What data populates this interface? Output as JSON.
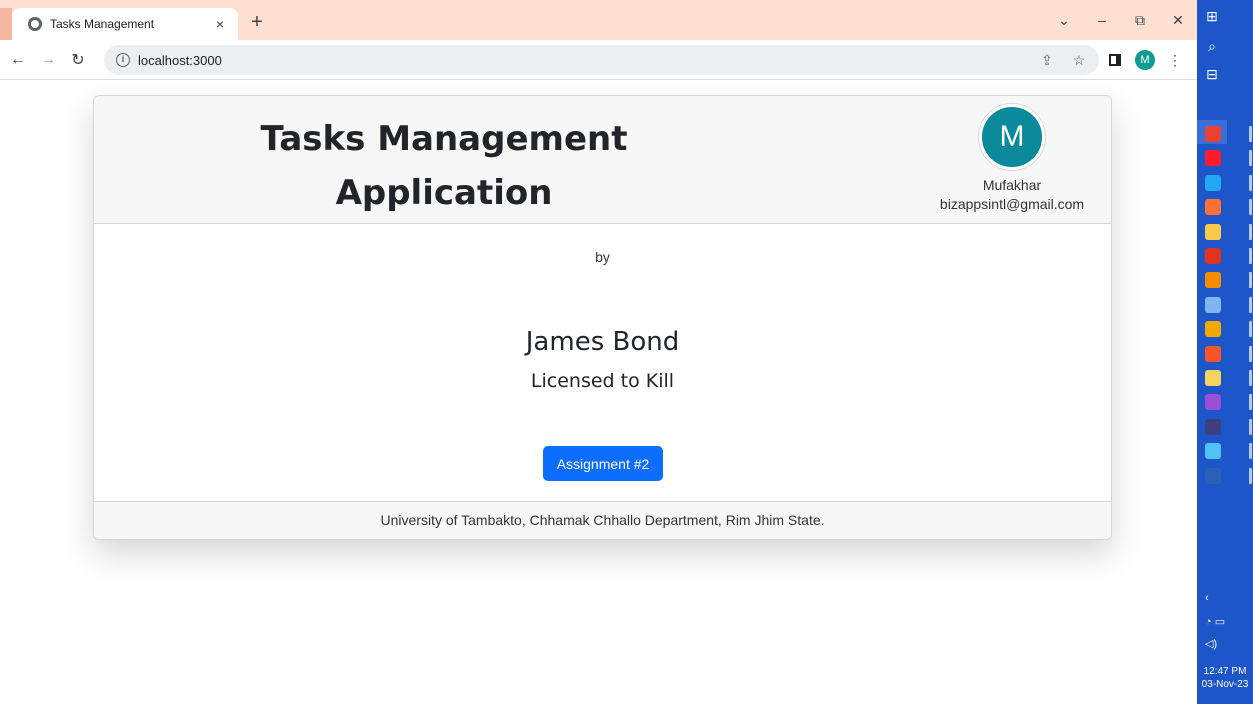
{
  "browser": {
    "tab_title": "Tasks Management",
    "tab_close": "×",
    "new_tab": "+",
    "url": "localhost:3000",
    "profile_initial": "M"
  },
  "header": {
    "title": "Tasks Management Application",
    "user": {
      "avatar_initial": "M",
      "name": "Mufakhar",
      "email": "bizappsintl@gmail.com"
    }
  },
  "body": {
    "by_label": "by",
    "author_name": "James Bond",
    "author_subtitle": "Licensed to Kill",
    "button_label": "Assignment #2"
  },
  "footer": {
    "text": "University of Tambakto, Chhamak Chhallo Department, Rim Jhim State."
  },
  "taskbar": {
    "time": "12:47 PM",
    "date": "03-Nov-23",
    "apps": [
      {
        "icon": "chrome-icon",
        "color": "#e94235"
      },
      {
        "icon": "opera-icon",
        "color": "#ff1b2d"
      },
      {
        "icon": "vscode-icon",
        "color": "#23a9f2"
      },
      {
        "icon": "firefox-icon",
        "color": "#ff7139"
      },
      {
        "icon": "file-explorer-icon",
        "color": "#f9c94b"
      },
      {
        "icon": "pdf-reader-icon",
        "color": "#e0321c"
      },
      {
        "icon": "vlc-icon",
        "color": "#f48b00"
      },
      {
        "icon": "notes-icon",
        "color": "#7fb3f2"
      },
      {
        "icon": "chrome-canary-icon",
        "color": "#f2a900"
      },
      {
        "icon": "brave-icon",
        "color": "#fb542b"
      },
      {
        "icon": "notepad-icon",
        "color": "#f4d35e"
      },
      {
        "icon": "visual-studio-icon",
        "color": "#9b4fd6"
      },
      {
        "icon": "terminal-icon",
        "color": "#3f3f7f"
      },
      {
        "icon": "remote-desktop-icon",
        "color": "#4fc3f7"
      },
      {
        "icon": "word-icon",
        "color": "#2b5fb8"
      }
    ]
  },
  "colors": {
    "primary_button": "#0d6efd",
    "avatar": "#0b8a9c",
    "taskbar": "#1c56c8"
  }
}
